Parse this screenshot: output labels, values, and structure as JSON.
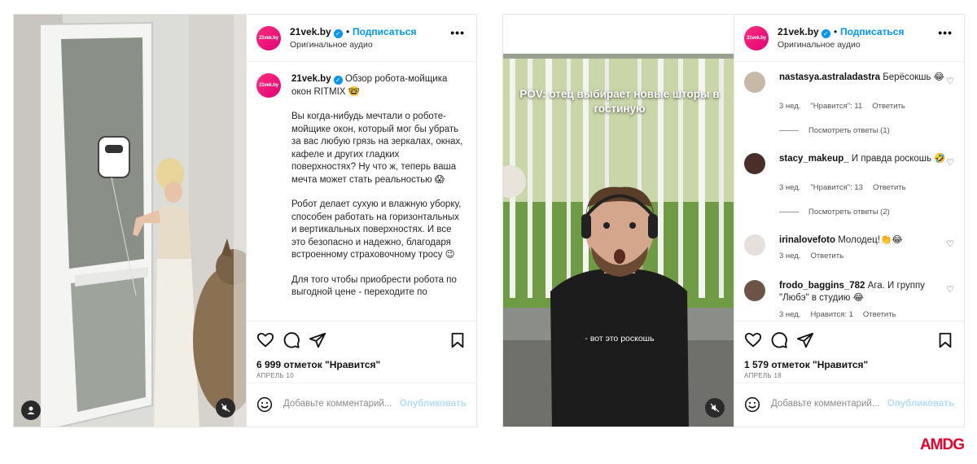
{
  "posts": [
    {
      "username": "21vek.by",
      "avatar_text": "21vek.by",
      "dot": "•",
      "follow": "Подписаться",
      "audio": "Оригинальное аудио",
      "more": "•••",
      "caption_title": "Обзор робота-мойщика окон RITMIX 🤓",
      "caption_p1": "Вы когда-нибудь мечтали о роботе-мойщике окон, который мог бы убрать за вас любую грязь на зеркалах, окнах, кафеле и других гладких поверхностях? Ну что ж, теперь ваша мечта может стать реальностью 😱",
      "caption_p2": "Робот делает сухую и влажную уборку, способен работать на горизонтальных и вертикальных поверхностях. И все это безопасно и надежно, благодаря встроенному страховочному тросу 😉",
      "caption_p3": "Для того чтобы приобрести робота по выгодной цене - переходите по",
      "likes": "6 999 отметок \"Нравится\"",
      "date": "АПРЕЛЬ 10",
      "comment_placeholder": "Добавьте комментарий...",
      "publish": "Опубликовать"
    },
    {
      "username": "21vek.by",
      "avatar_text": "21vek.by",
      "dot": "•",
      "follow": "Подписаться",
      "audio": "Оригинальное аудио",
      "more": "•••",
      "overlay_title": "POV: отец выбирает новые шторы в гостиную",
      "overlay_sub": "- вот это роскошь",
      "comments": [
        {
          "user": "nastasya.astraladastra",
          "text": "Берёсокшь 😂",
          "time": "3 нед.",
          "likes": "\"Нравится\": 11",
          "reply": "Ответить",
          "replies": "Посмотреть ответы (1)"
        },
        {
          "user": "stacy_makeup_",
          "text": "И правда роскошь 🤣",
          "time": "3 нед.",
          "likes": "\"Нравится\": 13",
          "reply": "Ответить",
          "replies": "Посмотреть ответы (2)"
        },
        {
          "user": "irinalovefoto",
          "text": "Молодец!👏😂",
          "time": "3 нед.",
          "likes": "",
          "reply": "Ответить",
          "replies": ""
        },
        {
          "user": "frodo_baggins_782",
          "text": "Ага. И группу \"Любэ\" в студию 😂",
          "time": "3 нед.",
          "likes": "Нравится: 1",
          "reply": "Ответить",
          "replies": ""
        }
      ],
      "likes": "1 579 отметок \"Нравится\"",
      "date": "АПРЕЛЬ 18",
      "comment_placeholder": "Добавьте комментарий...",
      "publish": "Опубликовать"
    }
  ],
  "brand": "AMDG",
  "colors": {
    "accent": "#0095f6",
    "brand": "#e4002b",
    "avatar": "#e0007a"
  },
  "icons": [
    "heart-icon",
    "comment-icon",
    "share-icon",
    "bookmark-icon",
    "mute-icon",
    "user-icon",
    "smile-icon",
    "verified-icon"
  ]
}
